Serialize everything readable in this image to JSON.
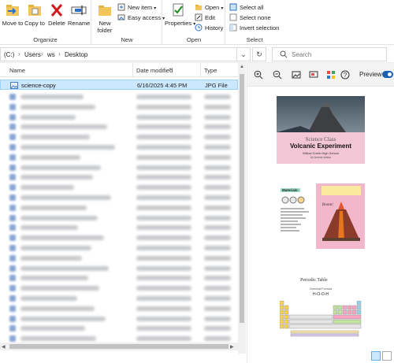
{
  "ribbon": {
    "organize": {
      "label": "Organize",
      "move_to": "Move to",
      "copy_to": "Copy to",
      "delete": "Delete",
      "rename": "Rename"
    },
    "new": {
      "label": "New",
      "new_folder": "New folder",
      "new_item": "New item",
      "easy_access": "Easy access"
    },
    "open": {
      "label": "Open",
      "properties": "Properties",
      "open": "Open",
      "edit": "Edit",
      "history": "History"
    },
    "select": {
      "label": "Select",
      "select_all": "Select all",
      "select_none": "Select none",
      "invert_selection": "Invert selection"
    }
  },
  "address": {
    "drive": "(C:)",
    "users": "Users",
    "user": "ws",
    "folder": "Desktop"
  },
  "search": {
    "placeholder": "Search"
  },
  "columns": {
    "name": "Name",
    "date": "Date modified",
    "type": "Type"
  },
  "files": [
    {
      "name": "science-copy",
      "date": "6/16/2025 4:45 PM",
      "type": "JPG File"
    }
  ],
  "preview": {
    "label": "Preview",
    "slide1": {
      "line1": "Science Class",
      "line2": "Volcanic Experiment",
      "line3": "Willow Creek High School",
      "line4": "Mr Amelia Walsh"
    },
    "slide2": {
      "heading": "Materials:",
      "label": "Boom!"
    },
    "slide3": {
      "title": "Periodic Table",
      "subtitle": "Chemical Formula",
      "formula": "H-O-O-H"
    }
  },
  "colors": {
    "selection": "#cce8ff",
    "accent": "#1a5fb4",
    "slide_pink": "#f3c6d6"
  }
}
